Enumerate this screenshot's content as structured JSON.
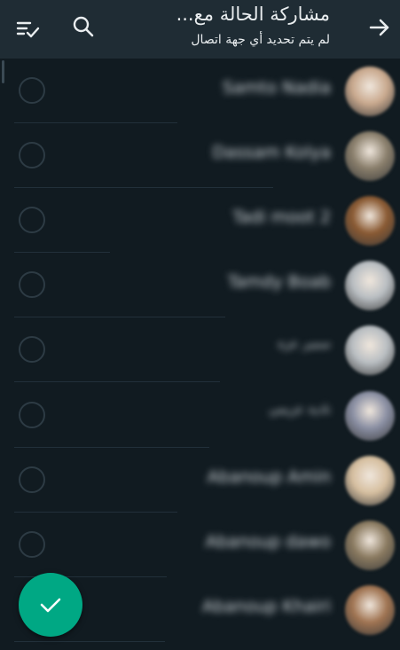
{
  "header": {
    "title": "مشاركة الحالة مع...",
    "subtitle": "لم يتم تحديد أي جهة اتصال",
    "back_icon": "arrow-right-icon",
    "search_icon": "search-icon",
    "select_all_icon": "list-check-icon"
  },
  "contacts": [
    {
      "name": "Samto Nadia",
      "avatar_color": "#c9a98e"
    },
    {
      "name": "Dassam Kolya",
      "avatar_color": "#8a7f6c"
    },
    {
      "name": "Tadi moot 2",
      "avatar_color": "#8a5a33"
    },
    {
      "name": "Tamdy Boab",
      "avatar_color": "#b9bec2"
    },
    {
      "name": "سمير عزة",
      "avatar_color": "#b9bec2"
    },
    {
      "name": "نادية عزيمي",
      "avatar_color": "#8a8fa3"
    },
    {
      "name": "Abanoup Amin",
      "avatar_color": "#d6bfa0"
    },
    {
      "name": "Abanoup dawo",
      "avatar_color": "#8a7a60"
    },
    {
      "name": "Abanoup Khairi",
      "avatar_color": "#a07452"
    }
  ],
  "fab": {
    "icon": "check-icon",
    "color": "#00a884"
  }
}
